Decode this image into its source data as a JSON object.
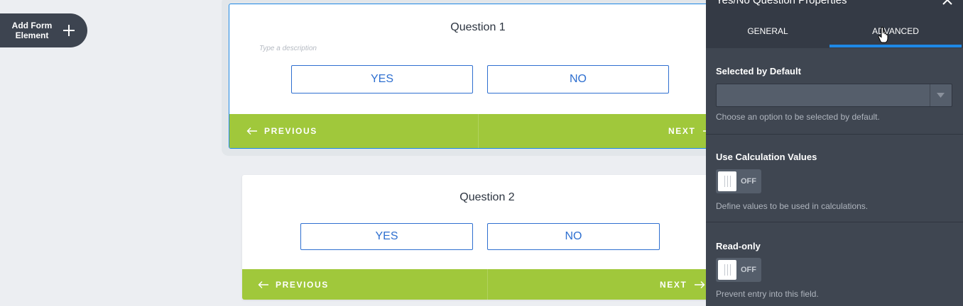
{
  "sidebar": {
    "add_button_label": "Add Form\nElement",
    "add_button_icon": "plus-icon"
  },
  "form": {
    "questions": [
      {
        "title": "Question 1",
        "description_placeholder": "Type a description",
        "yes_label": "YES",
        "no_label": "NO",
        "prev_label": "PREVIOUS",
        "next_label": "NEXT"
      },
      {
        "title": "Question 2",
        "yes_label": "YES",
        "no_label": "NO",
        "prev_label": "PREVIOUS",
        "next_label": "NEXT"
      }
    ]
  },
  "panel": {
    "title": "Yes/No Question Properties",
    "tabs": [
      {
        "label": "GENERAL",
        "active": false
      },
      {
        "label": "ADVANCED",
        "active": true
      }
    ],
    "sections": {
      "selected_default": {
        "label": "Selected by Default",
        "value": "",
        "help": "Choose an option to be selected by default."
      },
      "calc_values": {
        "label": "Use Calculation Values",
        "toggle": "OFF",
        "help": "Define values to be used in calculations."
      },
      "read_only": {
        "label": "Read-only",
        "toggle": "OFF",
        "help": "Prevent entry into this field."
      }
    }
  },
  "colors": {
    "accent_blue": "#1e88e5",
    "footer_green": "#a0c83b",
    "panel_bg": "#3f4651",
    "canvas_bg": "#eceef2"
  }
}
